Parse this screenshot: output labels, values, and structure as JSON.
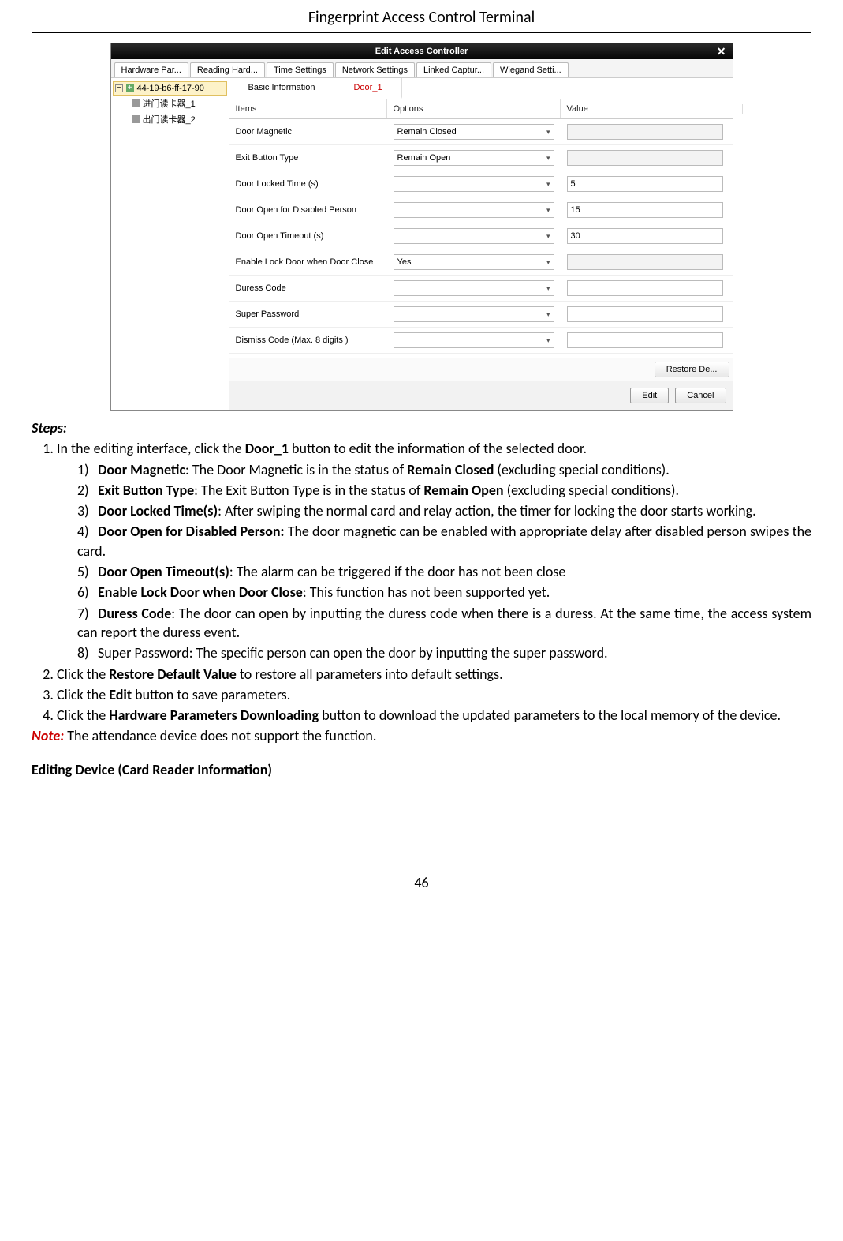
{
  "page": {
    "title": "Fingerprint Access Control Terminal",
    "number": "46"
  },
  "dialog": {
    "title": "Edit Access Controller",
    "close": "✕",
    "close_icon_name": "close-icon"
  },
  "topTabs": [
    "Hardware Par...",
    "Reading Hard...",
    "Time Settings",
    "Network Settings",
    "Linked Captur...",
    "Wiegand Setti..."
  ],
  "tree": {
    "root": "44-19-b6-ff-17-90",
    "children": [
      "进门读卡器_1",
      "出门读卡器_2"
    ]
  },
  "subTabs": {
    "basic": "Basic Information",
    "door": "Door_1"
  },
  "gridHead": {
    "items": "Items",
    "options": "Options",
    "value": "Value"
  },
  "rows": [
    {
      "label": "Door Magnetic",
      "option": "Remain Closed",
      "value": "",
      "valDisabled": true
    },
    {
      "label": "Exit Button Type",
      "option": "Remain Open",
      "value": "",
      "valDisabled": true
    },
    {
      "label": "Door Locked Time (s)",
      "option": "",
      "value": "5",
      "valDisabled": false
    },
    {
      "label": "Door Open for Disabled Person",
      "option": "",
      "value": "15",
      "valDisabled": false
    },
    {
      "label": "Door Open Timeout (s)",
      "option": "",
      "value": "30",
      "valDisabled": false
    },
    {
      "label": "Enable Lock Door when Door Close",
      "option": "Yes",
      "value": "",
      "valDisabled": true
    },
    {
      "label": "Duress Code",
      "option": "",
      "value": "",
      "valDisabled": false
    },
    {
      "label": "Super Password",
      "option": "",
      "value": "",
      "valDisabled": false
    },
    {
      "label": "Dismiss Code (Max. 8 digits )",
      "option": "",
      "value": "",
      "valDisabled": false
    }
  ],
  "buttons": {
    "restore": "Restore De...",
    "edit": "Edit",
    "cancel": "Cancel"
  },
  "doc": {
    "stepsLabel": "Steps:",
    "step1_pre": "In the editing interface, click the ",
    "step1_b": "Door_1",
    "step1_post": " button to edit the information of the selected door.",
    "sub": [
      {
        "n": "1)",
        "b": "Door Magnetic",
        "t1": ": The Door Magnetic is in the status of ",
        "b2": "Remain Closed",
        "t2": " (excluding special conditions)."
      },
      {
        "n": "2)",
        "b": "Exit Button Type",
        "t1": ": The Exit Button Type is in the status of ",
        "b2": "Remain Open",
        "t2": " (excluding special conditions)."
      },
      {
        "n": "3)",
        "b": "Door Locked Time(s)",
        "t1": ": After swiping the normal card and relay action, the timer for locking the door starts working.",
        "b2": "",
        "t2": ""
      },
      {
        "n": "4)",
        "b": "Door Open for Disabled Person:",
        "t1": " The door magnetic can be enabled with appropriate delay after disabled person swipes the card.",
        "b2": "",
        "t2": ""
      },
      {
        "n": "5)",
        "b": "Door Open Timeout(s)",
        "t1": ": The alarm can be triggered if the door has not been close",
        "b2": "",
        "t2": ""
      },
      {
        "n": "6)",
        "b": "Enable Lock Door when Door Close",
        "t1": ": This function has not been supported yet.",
        "b2": "",
        "t2": ""
      },
      {
        "n": "7)",
        "b": "Duress Code",
        "t1": ": The door can open by inputting the duress code when there is a duress. At the same time, the access system can report the duress event.",
        "b2": "",
        "t2": ""
      },
      {
        "n": "8)",
        "b": "",
        "t1": "Super Password: The specific person can open the door by inputting the super password.",
        "b2": "",
        "t2": ""
      }
    ],
    "step2_pre": "Click the ",
    "step2_b": "Restore Default Value",
    "step2_post": " to restore all parameters into default settings.",
    "step3_pre": "Click the ",
    "step3_b": "Edit",
    "step3_post": " button to save parameters.",
    "step4_pre": "Click the ",
    "step4_b": "Hardware Parameters Downloading",
    "step4_post": " button to download the updated parameters to the local memory of the device.",
    "noteLabel": "Note:",
    "noteText": " The attendance device does not support the function.",
    "subheading": "Editing Device (Card Reader Information)"
  }
}
